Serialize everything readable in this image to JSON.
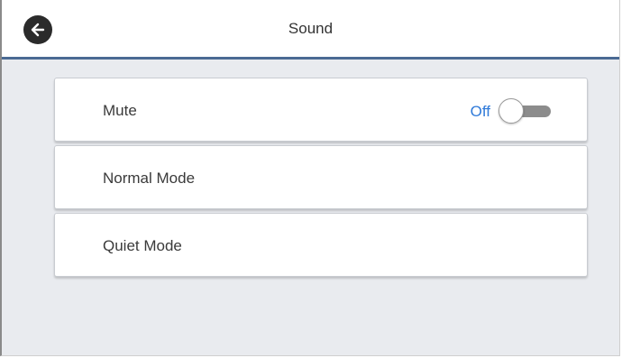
{
  "header": {
    "title": "Sound",
    "back_icon": "arrow-left-icon"
  },
  "items": [
    {
      "label": "Mute",
      "state": "Off",
      "toggle_on": false
    },
    {
      "label": "Normal Mode"
    },
    {
      "label": "Quiet Mode"
    }
  ],
  "colors": {
    "accent": "#2f7ad9",
    "header_rule": "#4a6a93",
    "background": "#e9ebef"
  }
}
